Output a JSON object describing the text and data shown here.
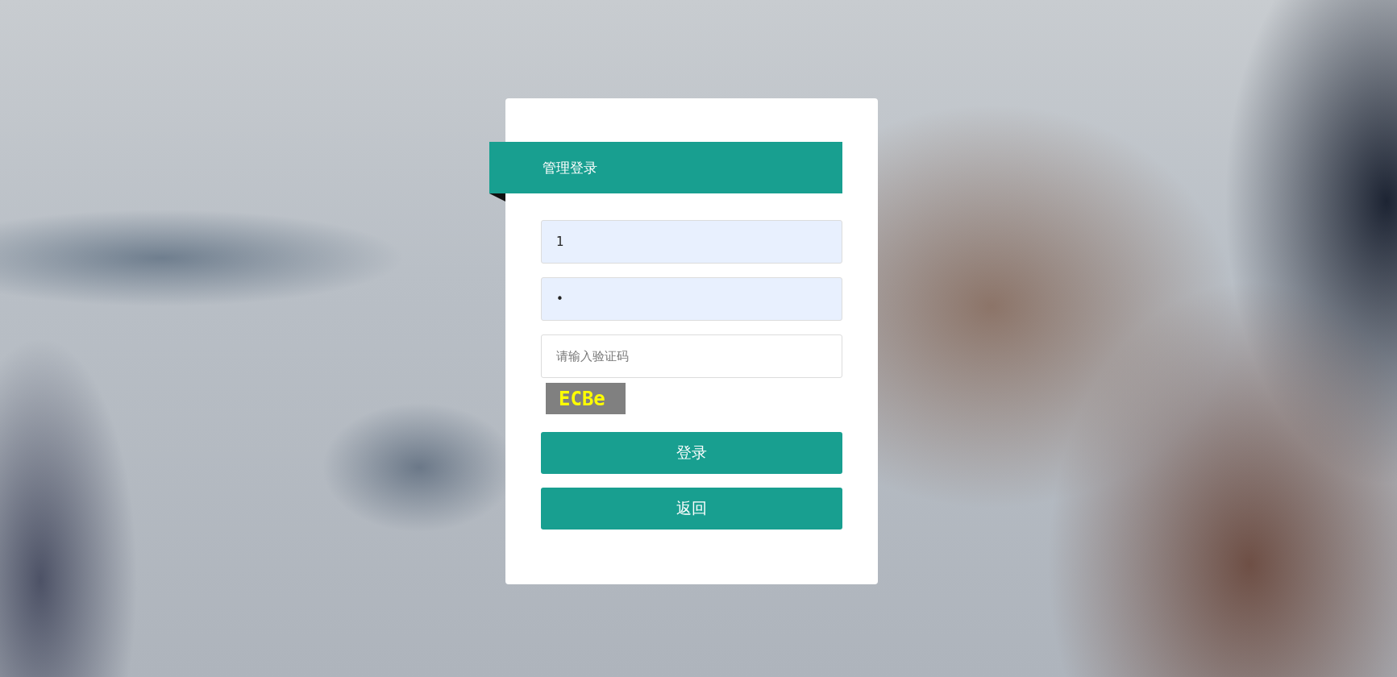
{
  "panel": {
    "title": "管理登录"
  },
  "fields": [
    {
      "value": "1",
      "autofilled": true
    },
    {
      "value": "•",
      "autofilled": true
    },
    {
      "placeholder": "请输入验证码",
      "autofilled": false
    }
  ],
  "captcha": {
    "text": "ECBe"
  },
  "buttons": [
    "登录",
    "返回"
  ]
}
